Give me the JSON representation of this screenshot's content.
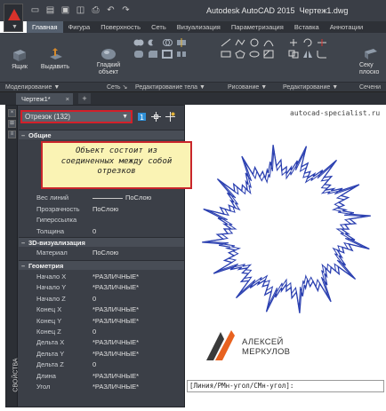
{
  "title_bar": {
    "app_title": "Autodesk AutoCAD 2015",
    "document": "Чертеж1.dwg",
    "qat_icons": [
      "new-icon",
      "open-icon",
      "save-icon",
      "save-as-icon",
      "print-icon",
      "undo-icon",
      "redo-icon"
    ]
  },
  "ribbon_tabs": [
    "Главная",
    "Фигура",
    "Поверхность",
    "Сеть",
    "Визуализация",
    "Параметризация",
    "Вставка",
    "Аннотации"
  ],
  "active_ribbon_tab": "Главная",
  "ribbon": {
    "box_label": "Ящик",
    "extrude_label": "Выдавить",
    "smooth_label_1": "Гладкий",
    "smooth_label_2": "объект",
    "section_label_1": "Секу",
    "section_label_2": "плоско"
  },
  "panels": {
    "modeling": "Моделирование",
    "mesh": "Сеть",
    "solid_editing": "Редактирование тела",
    "draw": "Рисование",
    "modify": "Редактирование",
    "section": "Сечени"
  },
  "doc_tabs": {
    "active": "Чертеж1*"
  },
  "palette": {
    "vertical_title": "СВОЙСТВА",
    "selection": "Отрезок (132)",
    "sections": {
      "general": "Общие",
      "viz3d": "3D-визуализация",
      "geometry": "Геометрия"
    },
    "callout_lines": [
      "Объект состоит из",
      "соединенных между собой",
      "отрезков"
    ],
    "general_rows": [
      {
        "label": "Вес линий",
        "value": "ПоСлою"
      },
      {
        "label": "Прозрачность",
        "value": "ПоСлою"
      },
      {
        "label": "Гиперссылка",
        "value": ""
      },
      {
        "label": "Толщина",
        "value": "0"
      }
    ],
    "viz_rows": [
      {
        "label": "Материал",
        "value": "ПоСлою"
      }
    ],
    "geometry_rows": [
      {
        "label": "Начало X",
        "value": "*РАЗЛИЧНЫЕ*"
      },
      {
        "label": "Начало Y",
        "value": "*РАЗЛИЧНЫЕ*"
      },
      {
        "label": "Начало Z",
        "value": "0"
      },
      {
        "label": "Конец X",
        "value": "*РАЗЛИЧНЫЕ*"
      },
      {
        "label": "Конец Y",
        "value": "*РАЗЛИЧНЫЕ*"
      },
      {
        "label": "Конец Z",
        "value": "0"
      },
      {
        "label": "Дельта X",
        "value": "*РАЗЛИЧНЫЕ*"
      },
      {
        "label": "Дельта Y",
        "value": "*РАЗЛИЧНЫЕ*"
      },
      {
        "label": "Дельта Z",
        "value": "0"
      },
      {
        "label": "Длина",
        "value": "*РАЗЛИЧНЫЕ*"
      },
      {
        "label": "Угол",
        "value": "*РАЗЛИЧНЫЕ*"
      }
    ]
  },
  "canvas": {
    "site_url": "autocad-specialist.ru",
    "logo_line1": "АЛЕКСЕЙ",
    "logo_line2": "МЕРКУЛОВ",
    "command_line": "[Линия/РМн-угол/СМн-угол]:"
  },
  "colors": {
    "star_stroke": "#2a3fb0",
    "callout_border": "#c9262c",
    "callout_fill": "#faf3b4",
    "logo_orange": "#e8621f",
    "app_red": "#d9322b"
  }
}
